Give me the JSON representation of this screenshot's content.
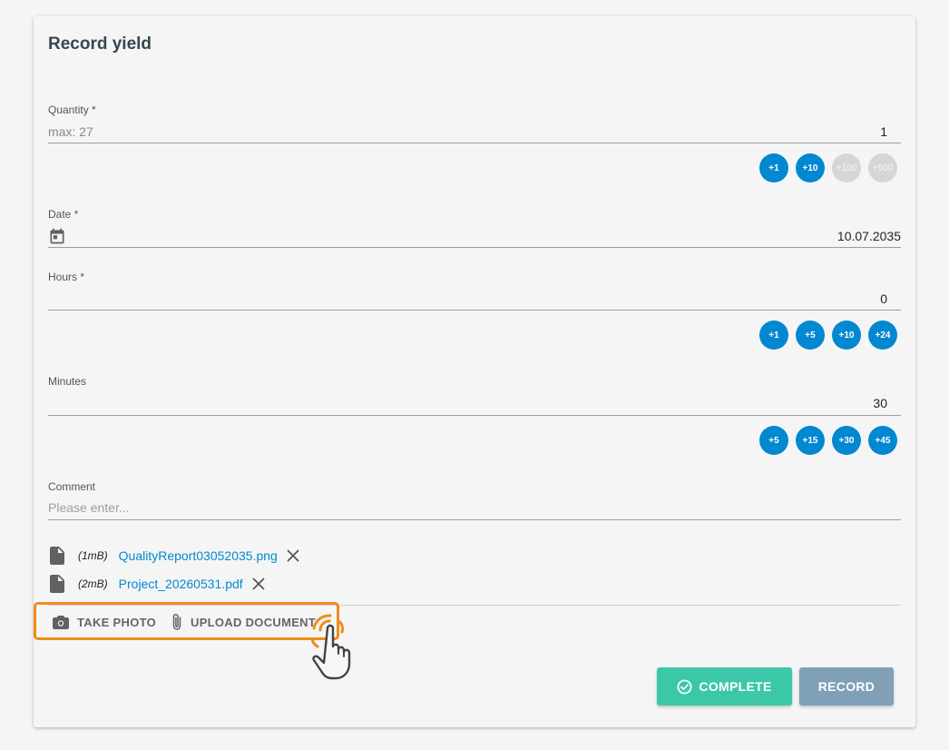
{
  "form": {
    "title": "Record yield",
    "quantity": {
      "label": "Quantity *",
      "hint": "max: 27",
      "value": "1",
      "increments": [
        {
          "label": "+1",
          "enabled": true
        },
        {
          "label": "+10",
          "enabled": true
        },
        {
          "label": "+100",
          "enabled": false
        },
        {
          "label": "+500",
          "enabled": false
        }
      ]
    },
    "date": {
      "label": "Date *",
      "value": "10.07.2035",
      "icon": "calendar-icon"
    },
    "hours": {
      "label": "Hours *",
      "value": "0",
      "increments": [
        {
          "label": "+1",
          "enabled": true
        },
        {
          "label": "+5",
          "enabled": true
        },
        {
          "label": "+10",
          "enabled": true
        },
        {
          "label": "+24",
          "enabled": true
        }
      ]
    },
    "minutes": {
      "label": "Minutes",
      "value": "30",
      "increments": [
        {
          "label": "+5",
          "enabled": true
        },
        {
          "label": "+15",
          "enabled": true
        },
        {
          "label": "+30",
          "enabled": true
        },
        {
          "label": "+45",
          "enabled": true
        }
      ]
    },
    "comment": {
      "label": "Comment",
      "placeholder": "Please enter..."
    }
  },
  "attachments": [
    {
      "size": "(1mB)",
      "name": "QualityReport03052035.png"
    },
    {
      "size": "(2mB)",
      "name": "Project_20260531.pdf"
    }
  ],
  "actions": {
    "take_photo": "TAKE PHOTO",
    "upload_document": "UPLOAD DOCUMENT"
  },
  "buttons": {
    "complete": "COMPLETE",
    "record": "RECORD"
  },
  "colors": {
    "accent": "#0288d1",
    "complete": "#3cc8a8",
    "record": "#7fa0b7",
    "highlight": "#f08c1a"
  }
}
